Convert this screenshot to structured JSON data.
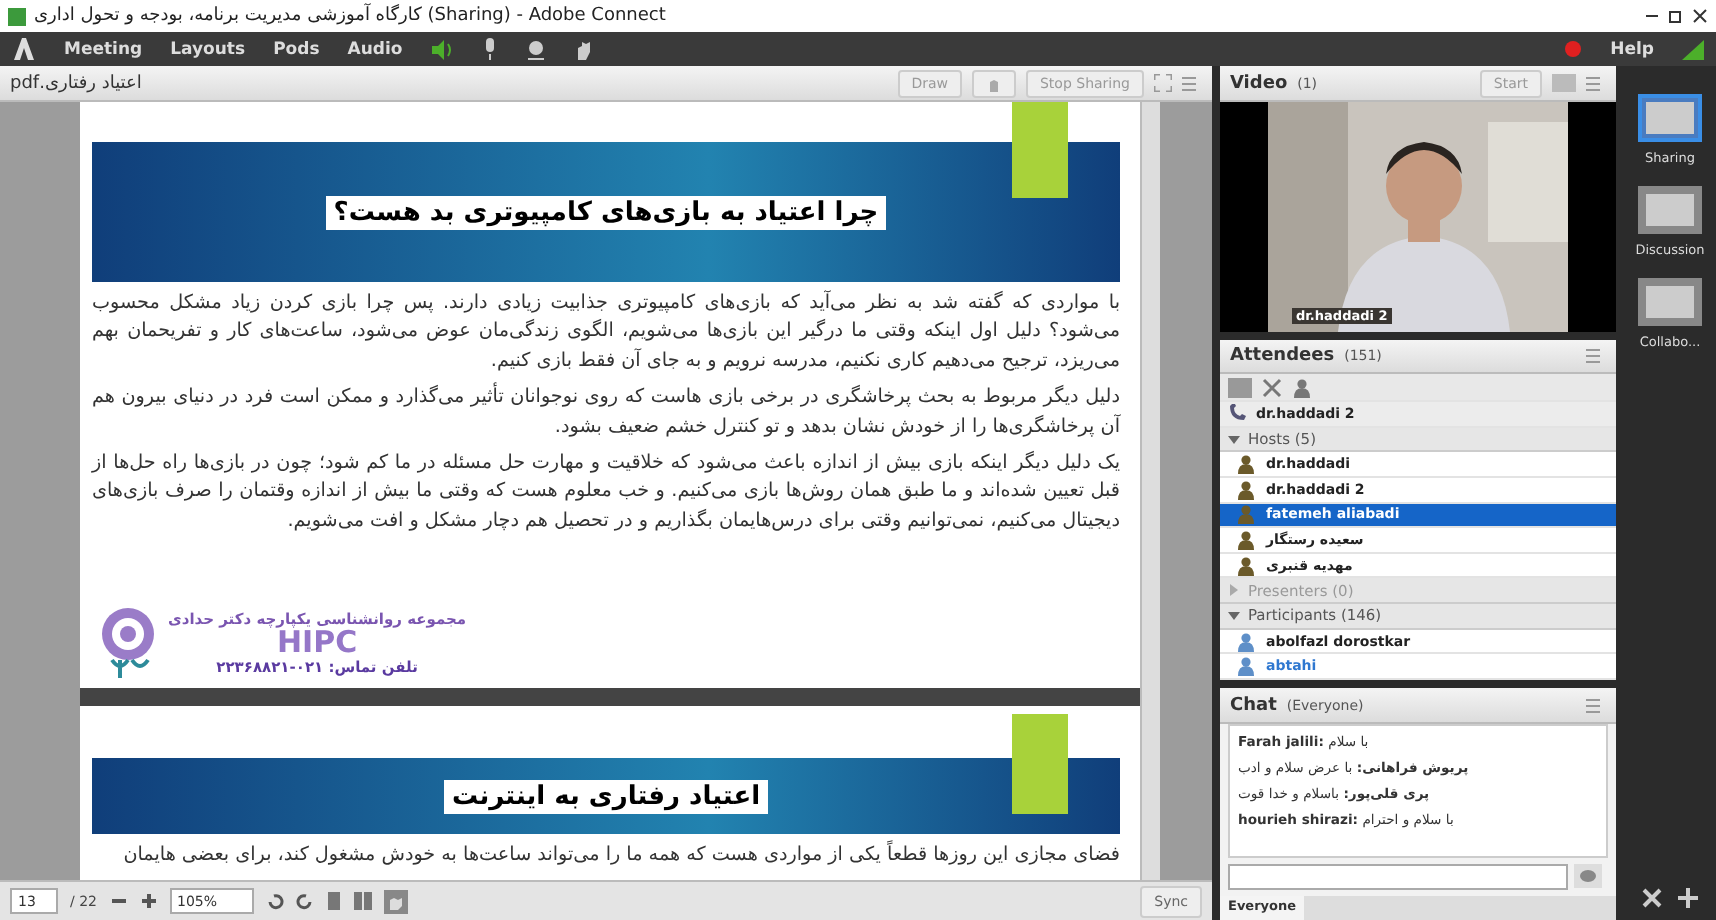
{
  "window": {
    "title": "کارگاه آموزشی مدیریت برنامه، بودجه و تحول اداری (Sharing) - Adobe Connect"
  },
  "menu": {
    "meeting": "Meeting",
    "layouts": "Layouts",
    "pods": "Pods",
    "audio": "Audio",
    "speaker_on": true,
    "recording": true,
    "help": "Help"
  },
  "share_pod": {
    "filename": "اعتیاد رفتاری.pdf",
    "draw_button": "Draw",
    "stop_sharing_button": "Stop Sharing",
    "pages": [
      {
        "title": "چرا اعتیاد به بازی‌های کامپیوتری بد هست؟",
        "paragraphs": [
          "با مواردی که گفته شد به نظر می‌آید که بازی‌های کامپیوتری جذابیت زیادی دارند. پس چرا بازی کردن زیاد مشکل محسوب می‌شود؟ دلیل اول اینکه وقتی ما درگیر این بازی‌ها می‌شویم، الگوی زندگی‌مان عوض می‌شود، ساعت‌های کار و تفریحمان بهم می‌ریزد، ترجیح می‌دهیم کاری نکنیم، مدرسه نرویم و به جای آن فقط بازی کنیم.",
          "دلیل دیگر مربوط به بحث پرخاشگری در برخی بازی هاست که روی نوجوانان تأثیر می‌گذارد و ممکن است فرد در دنیای بیرون هم آن پرخاشگری‌ها را از خودش نشان بدهد و تو کنترل خشم ضعیف بشود.",
          "یک دلیل دیگر اینکه بازی بیش از اندازه باعث می‌شود که خلاقیت و مهارت حل مسئله در ما کم شود؛ چون در بازی‌ها راه حل‌ها از قبل تعیین شده‌اند و ما طبق همان روش‌ها بازی می‌کنیم. و خب معلوم هست که وقتی ما بیش از اندازه وقتمان را صرف بازی‌های دیجیتال می‌کنیم، نمی‌توانیم وقتی برای درس‌هایمان بگذاریم و در تحصیل هم دچار مشکل و افت می‌شویم."
        ],
        "logo": {
          "org": "مجموعه روانشناسی یکپارچه دکتر حدادی",
          "name": "HIPC",
          "phone": "تلفن تماس: ۰۲۱-۲۲۳۶۸۸۲۱"
        }
      },
      {
        "title": "اعتیاد رفتاری به اینترنت",
        "paragraphs": [
          "فضای مجازی این روزها قطعاً یکی از مواردی هست که همه ما را می‌تواند ساعت‌ها به خودش مشغول کند، برای بعضی هایمان"
        ]
      }
    ],
    "footer": {
      "page": "13",
      "total": "/ 22",
      "zoom": "105%",
      "sync": "Sync"
    }
  },
  "video": {
    "title": "Video",
    "count": "(1)",
    "start": "Start",
    "name": "dr.haddadi 2"
  },
  "attendees": {
    "title": "Attendees",
    "count": "(151)",
    "me": "dr.haddadi 2",
    "groups": [
      {
        "label": "Hosts (5)",
        "expanded": true,
        "people": [
          {
            "name": "dr.haddadi",
            "selected": false,
            "highlighted": false
          },
          {
            "name": "dr.haddadi 2",
            "selected": false,
            "highlighted": false
          },
          {
            "name": "fatemeh aliabadi",
            "selected": true,
            "highlighted": false
          },
          {
            "name": "سعیده رستگار",
            "selected": false,
            "highlighted": false
          },
          {
            "name": "مهدیه قنبری",
            "selected": false,
            "highlighted": false
          }
        ]
      },
      {
        "label": "Presenters (0)",
        "expanded": false
      },
      {
        "label": "Participants (146)",
        "expanded": true,
        "people": [
          {
            "name": "abolfazl dorostkar",
            "selected": false,
            "highlighted": false
          },
          {
            "name": "abtahi",
            "selected": false,
            "highlighted": true
          }
        ]
      }
    ]
  },
  "chat": {
    "title": "Chat",
    "scope": "(Everyone)",
    "messages": [
      {
        "sender": "Farah jalili:",
        "text": "با سلام"
      },
      {
        "sender": "پریوش فراهانی:",
        "text": "با عرض سلام و ادب"
      },
      {
        "sender": "پری قلی‌پور:",
        "text": "باسلام و خدا قوت"
      },
      {
        "sender": "hourieh shirazi:",
        "text": "با سلام و احترام"
      }
    ],
    "tab": "Everyone"
  },
  "layouts": [
    {
      "label": "Sharing",
      "selected": true
    },
    {
      "label": "Discussion",
      "selected": false
    },
    {
      "label": "Collabo...",
      "selected": false
    }
  ]
}
